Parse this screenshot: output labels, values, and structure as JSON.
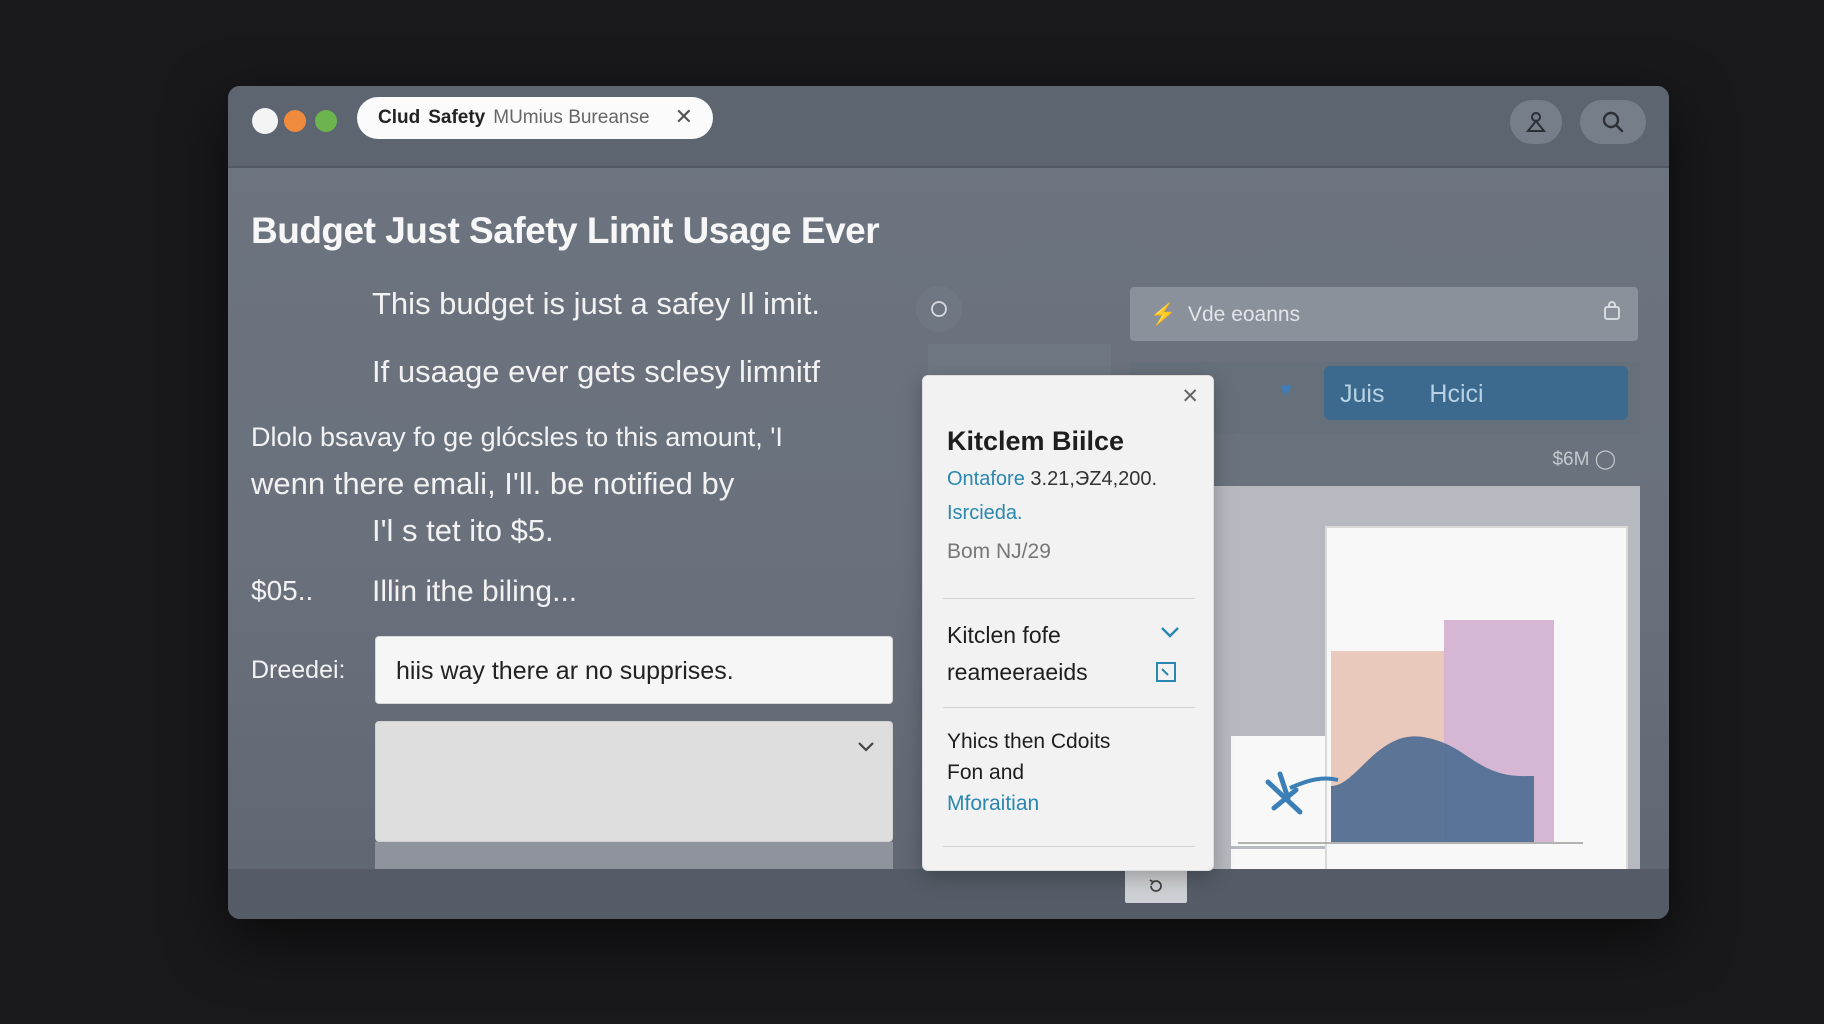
{
  "window": {
    "tab": {
      "title_bold": "Clud",
      "title_mid": "Safety",
      "title_light": "MUmius Bureanse"
    },
    "toolbar_icons": [
      "user-icon",
      "search-icon"
    ]
  },
  "main": {
    "heading": "Budget Just Safety Limit Usage Ever",
    "lines": [
      "This budget is  just a safey Il imit.",
      "If usaage ever gets sclesy limnitf",
      "Dlolo bsavay fo ge glócsles to this amount, 'I",
      "wenn there emali, I'll. be notified by",
      "I'l s tet ito $5.",
      "$05..",
      "Illin ithe biling..."
    ],
    "field_label": "Dreedei:",
    "input_value": "hiis way there ar no supprises."
  },
  "right": {
    "search_placeholder": "Vde eoanns",
    "pill_labels": [
      "Juis",
      "Hcici"
    ],
    "amount": "$6M"
  },
  "popover": {
    "title": "Kitclem Biilce",
    "meta_link": "Ontafore",
    "meta_date": "3.21,ЭZ4,200.",
    "meta_link2": "Isrcieda.",
    "ref": "Bom NJ/29",
    "section2_line1": "Kitclen fofe",
    "section2_line2": "reameeraeids",
    "section3_line1": "Yhics then Cdoits",
    "section3_line2": "Fon and",
    "section3_link": "Mforaitian"
  },
  "chart_data": {
    "type": "bar",
    "categories": [
      "",
      ""
    ],
    "series": [
      {
        "values": [
          0.86,
          1.0
        ],
        "colors": [
          "#e8c6b8",
          "#d3b3d1"
        ]
      }
    ],
    "overlay": "area",
    "colors": {
      "area": "#4f6d92",
      "accent": "#3c7fb6"
    }
  }
}
